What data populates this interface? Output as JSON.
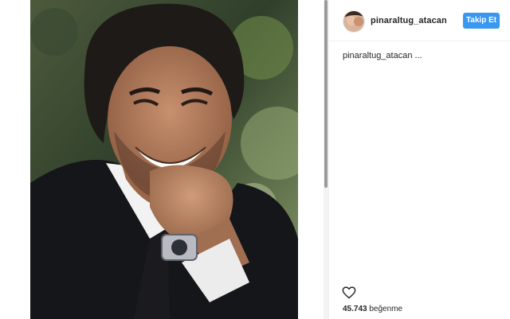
{
  "post": {
    "username": "pinaraltug_atacan",
    "follow_label": "Takip Et",
    "caption": "pinaraltug_atacan ...",
    "likes_count": "45.743",
    "likes_label": "beğenme",
    "like_icon": "heart-outline-icon"
  },
  "colors": {
    "follow_button": "#3897f0",
    "text": "#262626",
    "divider": "#efefef"
  }
}
